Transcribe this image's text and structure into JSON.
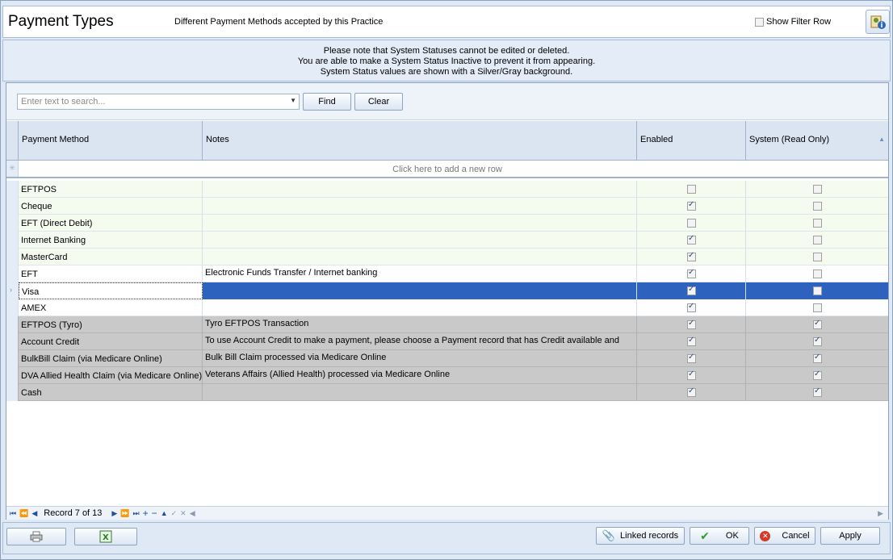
{
  "header": {
    "title": "Payment Types",
    "subtitle": "Different Payment Methods accepted by this Practice",
    "show_filter_label": "Show Filter Row",
    "show_filter_checked": false
  },
  "notice": {
    "line1": "Please note that System Statuses cannot be edited or deleted.",
    "line2": "You are able to make a System Status Inactive to prevent it from appearing.",
    "line3": "System Status values are shown with a Silver/Gray background."
  },
  "search": {
    "placeholder": "Enter text to search...",
    "find_label": "Find",
    "clear_label": "Clear"
  },
  "grid": {
    "columns": [
      "Payment Method",
      "Notes",
      "Enabled",
      "System (Read Only)"
    ],
    "new_row_text": "Click here to add a new row",
    "rows": [
      {
        "method": "EFTPOS",
        "notes": "",
        "enabled": false,
        "system": false,
        "style": "green"
      },
      {
        "method": "Cheque",
        "notes": "",
        "enabled": true,
        "system": false,
        "style": "green"
      },
      {
        "method": "EFT (Direct Debit)",
        "notes": "",
        "enabled": false,
        "system": false,
        "style": "green"
      },
      {
        "method": "Internet Banking",
        "notes": "",
        "enabled": true,
        "system": false,
        "style": "green"
      },
      {
        "method": "MasterCard",
        "notes": "",
        "enabled": true,
        "system": false,
        "style": "green"
      },
      {
        "method": "EFT",
        "notes": "Electronic Funds Transfer / Internet banking",
        "enabled": true,
        "system": false,
        "style": "white"
      },
      {
        "method": "Visa",
        "notes": "",
        "enabled": true,
        "system": false,
        "style": "sel"
      },
      {
        "method": "AMEX",
        "notes": "",
        "enabled": true,
        "system": false,
        "style": "white"
      },
      {
        "method": "EFTPOS (Tyro)",
        "notes": "Tyro EFTPOS Transaction",
        "enabled": true,
        "system": true,
        "style": "gray"
      },
      {
        "method": "Account Credit",
        "notes": "To use Account Credit to make a payment, please choose a Payment record that has Credit available and",
        "enabled": true,
        "system": true,
        "style": "gray"
      },
      {
        "method": "BulkBill Claim (via Medicare Online)",
        "notes": "Bulk Bill Claim processed via Medicare Online",
        "enabled": true,
        "system": true,
        "style": "gray"
      },
      {
        "method": "DVA Allied Health Claim (via Medicare Online)",
        "notes": "Veterans Affairs (Allied Health) processed via Medicare Online",
        "enabled": true,
        "system": true,
        "style": "gray"
      },
      {
        "method": "Cash",
        "notes": "",
        "enabled": true,
        "system": true,
        "style": "gray"
      }
    ]
  },
  "navigator": {
    "record_text": "Record 7 of 13"
  },
  "footer": {
    "linked_records_label": "Linked records",
    "ok_label": "OK",
    "cancel_label": "Cancel",
    "apply_label": "Apply"
  },
  "icons": {
    "print": "print-icon",
    "excel": "excel-icon",
    "linked": "paperclip-icon",
    "ok": "checkmark-icon",
    "cancel": "cancel-icon",
    "corner": "settings-info-icon"
  }
}
